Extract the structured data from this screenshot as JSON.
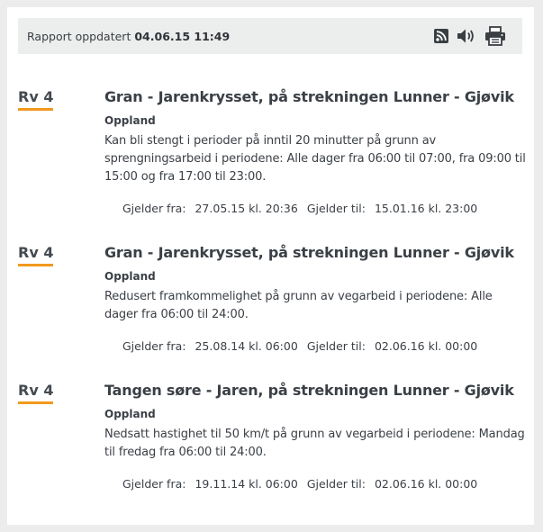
{
  "header": {
    "updated_label": "Rapport oppdatert",
    "updated_value": "04.06.15 11:49",
    "icons": [
      "rss-icon",
      "speaker-icon",
      "printer-icon"
    ]
  },
  "items": [
    {
      "road": "Rv 4",
      "title": "Gran - Jarenkrysset, på strekningen Lunner - Gjøvik",
      "county": "Oppland",
      "description": "Kan bli stengt i perioder på inntil 20 minutter på grunn av sprengningsarbeid i periodene: Alle dager fra 06:00 til 07:00, fra 09:00 til 15:00 og fra 17:00 til 23:00.",
      "from_label": "Gjelder fra:",
      "from_value": "27.05.15 kl. 20:36",
      "to_label": "Gjelder til:",
      "to_value": "15.01.16 kl. 23:00"
    },
    {
      "road": "Rv 4",
      "title": "Gran - Jarenkrysset, på strekningen Lunner - Gjøvik",
      "county": "Oppland",
      "description": "Redusert framkommelighet på grunn av vegarbeid i periodene: Alle dager fra 06:00 til 24:00.",
      "from_label": "Gjelder fra:",
      "from_value": "25.08.14 kl. 06:00",
      "to_label": "Gjelder til:",
      "to_value": "02.06.16 kl. 00:00"
    },
    {
      "road": "Rv 4",
      "title": "Tangen søre - Jaren, på strekningen Lunner - Gjøvik",
      "county": "Oppland",
      "description": "Nedsatt hastighet til 50 km/t på grunn av vegarbeid i periodene: Mandag til fredag fra 06:00 til 24:00.",
      "from_label": "Gjelder fra:",
      "from_value": "19.11.14 kl. 06:00",
      "to_label": "Gjelder til:",
      "to_value": "02.06.16 kl. 00:00"
    }
  ],
  "colors": {
    "accent_underline": "#f19a1d",
    "header_bg": "#eceded"
  }
}
